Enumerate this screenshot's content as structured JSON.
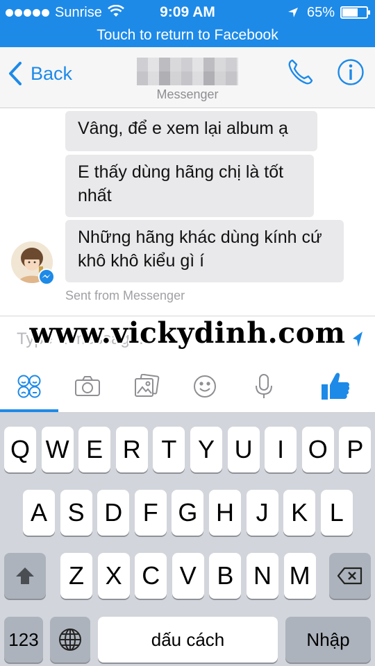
{
  "status_bar": {
    "carrier": "Sunrise",
    "time": "9:09 AM",
    "battery": "65%",
    "battery_level": 0.65
  },
  "return_banner": "Touch to return to Facebook",
  "header": {
    "back_label": "Back",
    "subtitle": "Messenger"
  },
  "messages": [
    {
      "text": "Vâng, để e xem lại album ạ"
    },
    {
      "text": "E thấy dùng hãng chị là tốt nhất"
    },
    {
      "text": "Những hãng khác dùng kính cứ khô khô kiểu gì í"
    }
  ],
  "sent_from": "Sent from Messenger",
  "composer": {
    "placeholder": "Type a message...",
    "watermark": "www.vickydinh.com"
  },
  "keyboard": {
    "row1": [
      "Q",
      "W",
      "E",
      "R",
      "T",
      "Y",
      "U",
      "I",
      "O",
      "P"
    ],
    "row2": [
      "A",
      "S",
      "D",
      "F",
      "G",
      "H",
      "J",
      "K",
      "L"
    ],
    "row3": [
      "Z",
      "X",
      "C",
      "V",
      "B",
      "N",
      "M"
    ],
    "numbers_key": "123",
    "space_key": "dấu cách",
    "return_key": "Nhập"
  },
  "colors": {
    "accent": "#1d8ae8",
    "bubble": "#e9e9eb",
    "keyboard_bg": "#d2d5db"
  },
  "icons": [
    "signal-dots-icon",
    "wifi-icon",
    "location-arrow-icon",
    "battery-icon",
    "back-chevron-icon",
    "phone-icon",
    "info-icon",
    "send-icon",
    "stickers-icon",
    "camera-icon",
    "gallery-icon",
    "emoji-icon",
    "microphone-icon",
    "like-icon",
    "shift-icon",
    "delete-icon",
    "globe-icon"
  ]
}
